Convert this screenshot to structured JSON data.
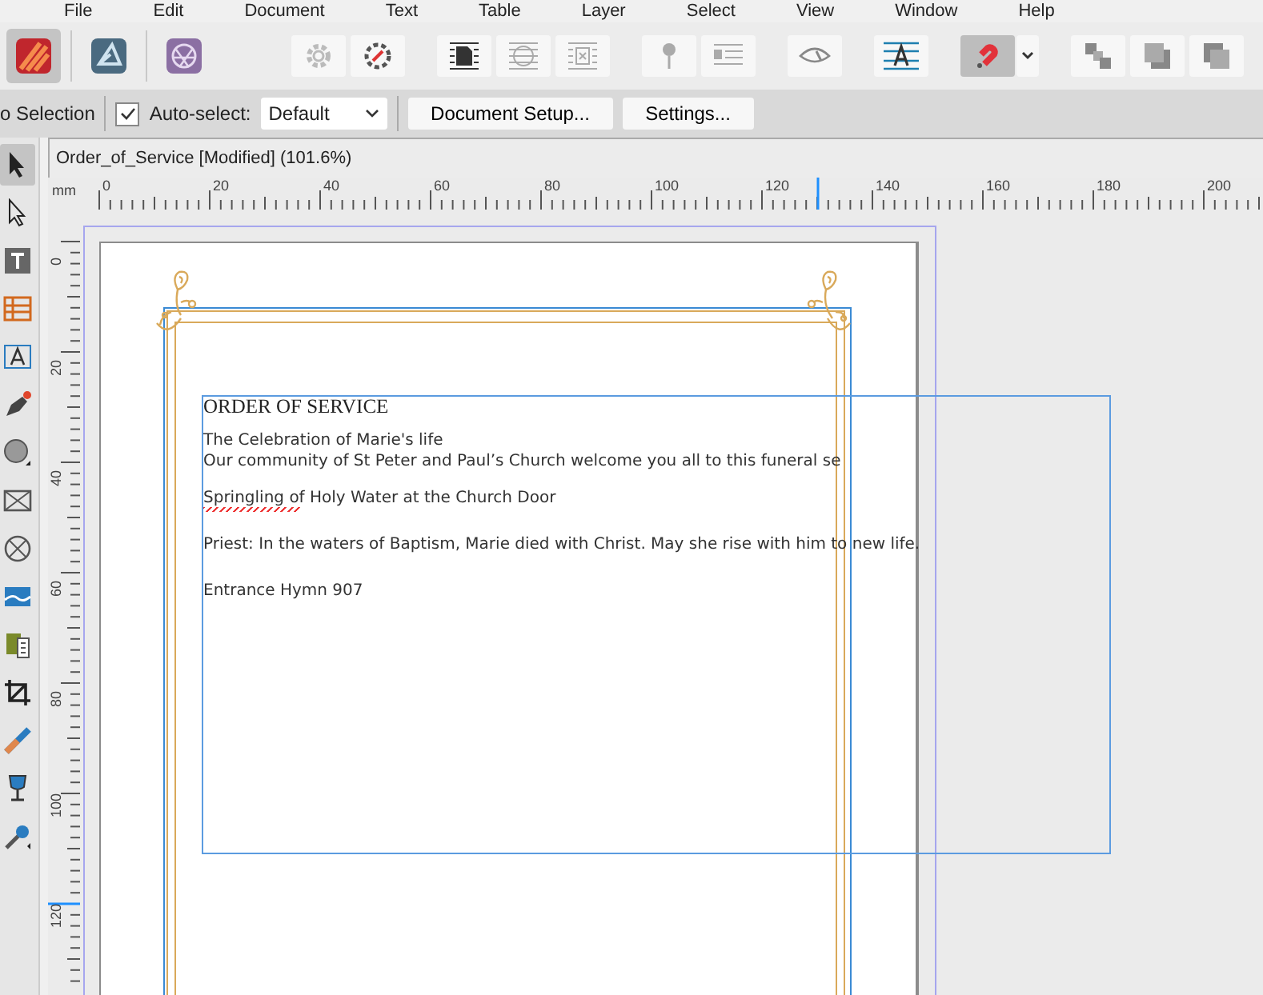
{
  "menu": [
    "File",
    "Edit",
    "Document",
    "Text",
    "Table",
    "Layer",
    "Select",
    "View",
    "Window",
    "Help"
  ],
  "personas": [
    {
      "kind": "publisher",
      "selected": true
    },
    {
      "kind": "designer",
      "selected": false
    },
    {
      "kind": "photo",
      "selected": false
    }
  ],
  "toolbar": [
    {
      "kind": "gear",
      "on": false
    },
    {
      "kind": "compass",
      "on": false
    },
    {
      "kind": "wrap-square",
      "on": false
    },
    {
      "kind": "wrap-round",
      "on": false
    },
    {
      "kind": "wrap-none",
      "on": false
    },
    {
      "kind": "pin",
      "on": false
    },
    {
      "kind": "text-list",
      "on": false
    },
    {
      "kind": "eye",
      "on": false
    },
    {
      "kind": "baseline",
      "on": false
    },
    {
      "kind": "magnet",
      "on": true
    },
    {
      "kind": "caret",
      "on": false
    },
    {
      "kind": "arrange-back",
      "on": false
    },
    {
      "kind": "arrange-mid",
      "on": false
    },
    {
      "kind": "arrange-front",
      "on": false
    }
  ],
  "context": {
    "selection": "o Selection",
    "auto_select": {
      "label": "Auto-select:",
      "checked": true
    },
    "dropdown": "Default",
    "buttons": [
      "Document Setup...",
      "Settings..."
    ]
  },
  "document_tab": "Order_of_Service [Modified] (101.6%)",
  "tools": [
    {
      "kind": "pointer",
      "selected": true
    },
    {
      "kind": "node",
      "selected": false
    },
    {
      "kind": "frame-text",
      "selected": false
    },
    {
      "kind": "table",
      "selected": false
    },
    {
      "kind": "artistic-text",
      "selected": false
    },
    {
      "kind": "pen",
      "selected": false
    },
    {
      "kind": "ellipse",
      "selected": false
    },
    {
      "kind": "rect-frame",
      "selected": false
    },
    {
      "kind": "ellipse-frame",
      "selected": false
    },
    {
      "kind": "picture",
      "selected": false
    },
    {
      "kind": "place",
      "selected": false
    },
    {
      "kind": "crop",
      "selected": false
    },
    {
      "kind": "fill",
      "selected": false
    },
    {
      "kind": "transparency",
      "selected": false
    },
    {
      "kind": "eyedropper",
      "selected": false
    }
  ],
  "ruler": {
    "unit": "mm",
    "horizontal": [
      "0",
      "20",
      "40",
      "60",
      "80",
      "100",
      "120",
      "140",
      "160",
      "180",
      "200"
    ],
    "vertical": [
      "0",
      "20",
      "40",
      "60",
      "80",
      "100",
      "120"
    ]
  },
  "document": {
    "heading": "ORDER OF SERVICE",
    "overlap": [
      "The Celebration of Marie's life",
      "Our community of St Peter and Paul’s Church welcome you all to this funeral se"
    ],
    "lines": [
      {
        "text": "Springling of Holy Water at the Church Door",
        "spelling_error": true
      },
      {
        "text": "Priest: In the waters of Baptism, Marie died with Christ. May she rise with him to new life.",
        "spelling_error": false
      },
      {
        "text": "Entrance Hymn 907",
        "spelling_error": false
      }
    ]
  }
}
